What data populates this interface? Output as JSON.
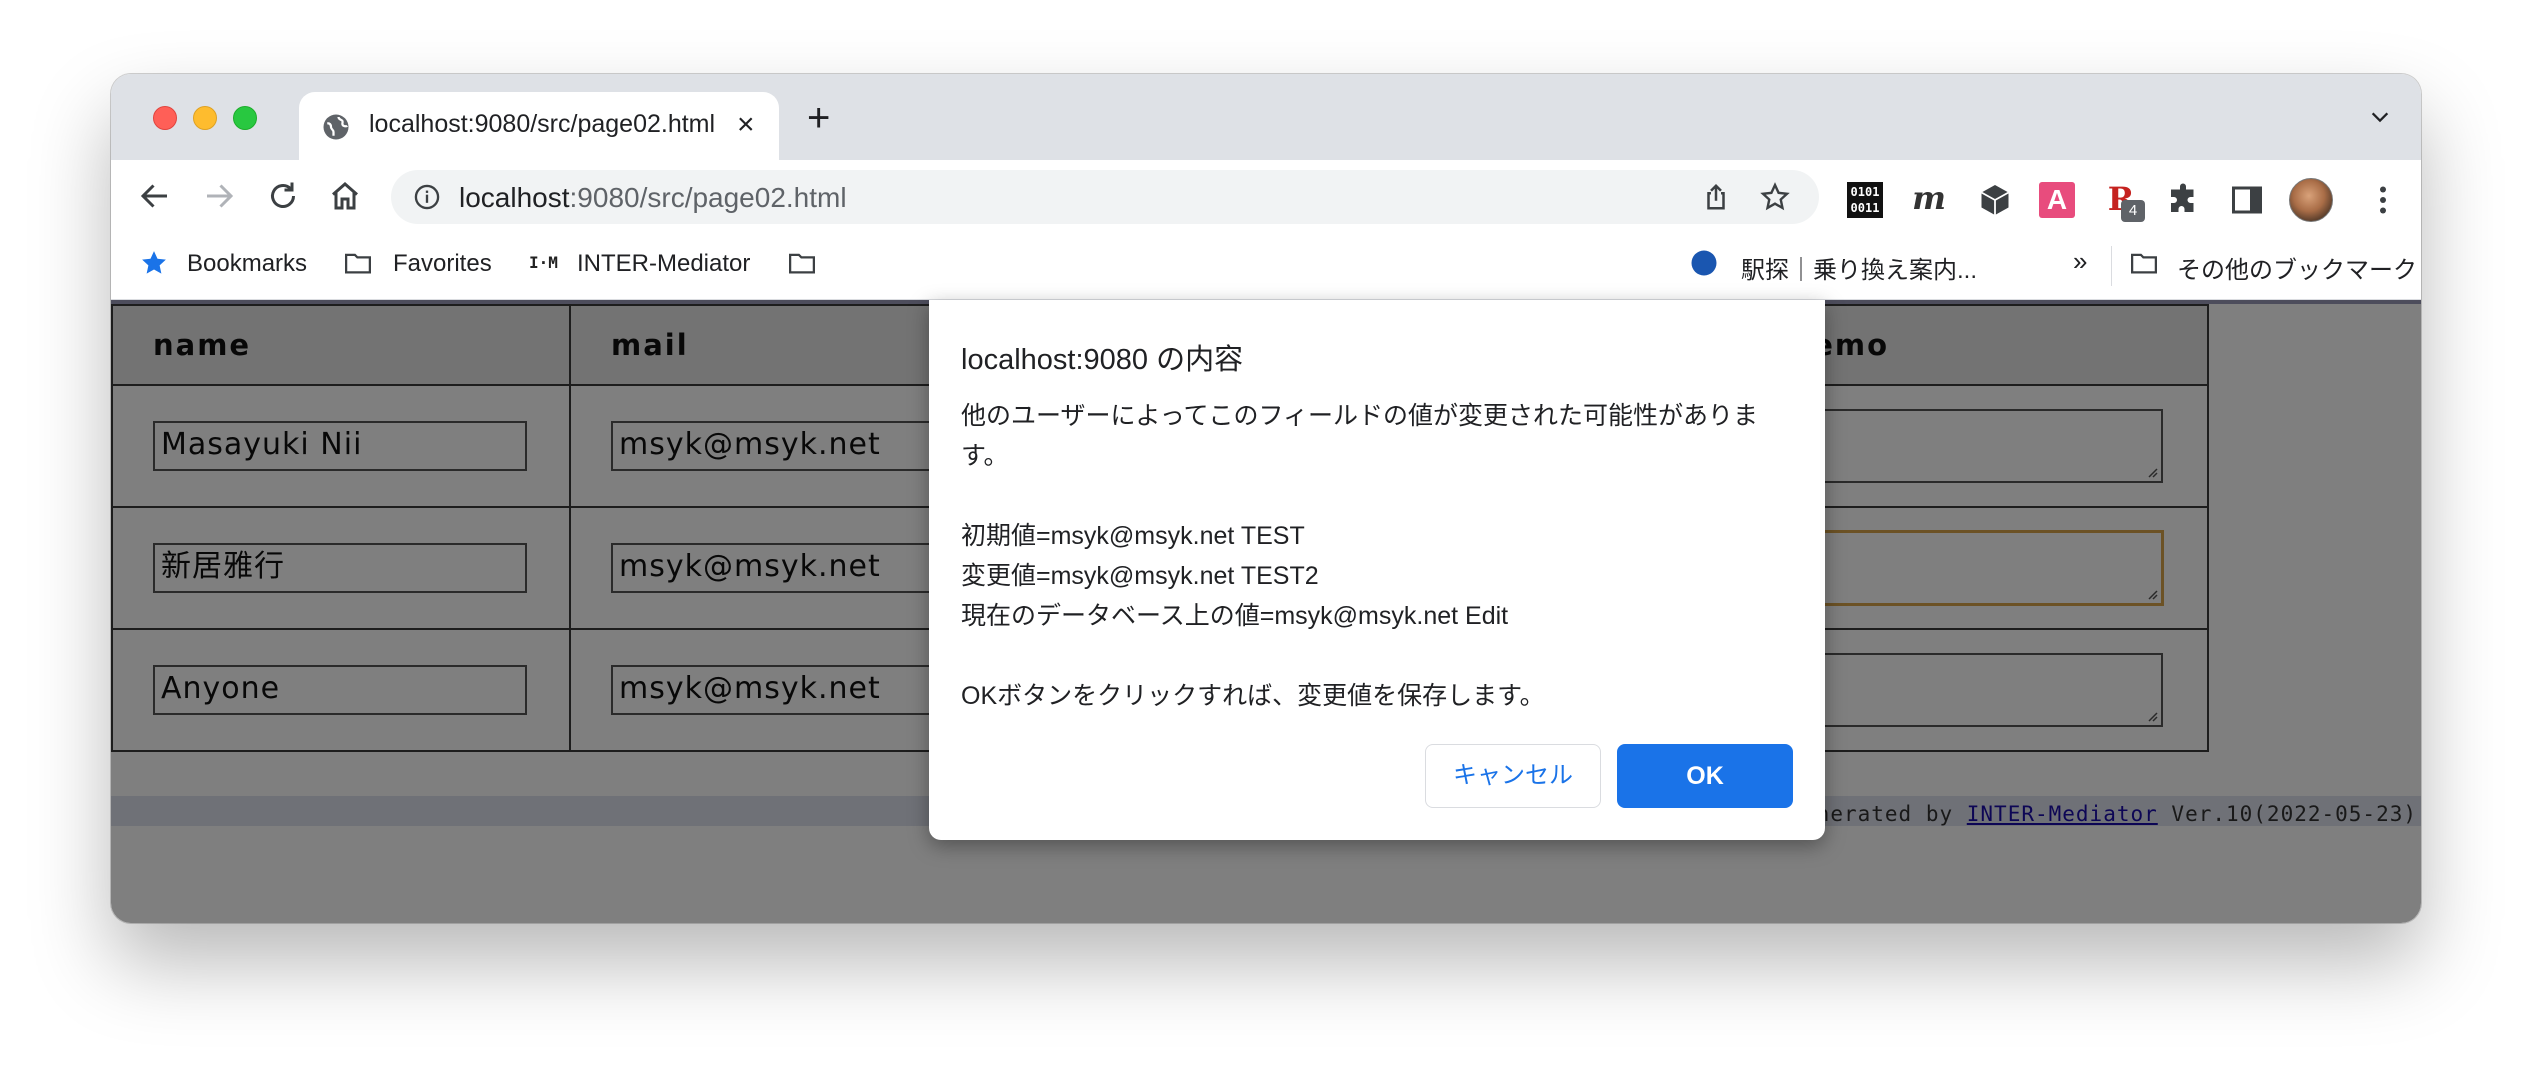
{
  "browser": {
    "tab_title": "localhost:9080/src/page02.html",
    "tab_close": "×",
    "new_tab": "+",
    "url_host": "localhost",
    "url_path": ":9080/src/page02.html",
    "profile_badge": "4",
    "extensions": {
      "binary_line1": "0101",
      "binary_line2": "0011",
      "m_label": "m",
      "a_label": "A",
      "r_label": "R"
    }
  },
  "bookmarks": {
    "items": [
      {
        "label": "Bookmarks"
      },
      {
        "label": "Favorites"
      },
      {
        "label": "INTER-Mediator"
      },
      {
        "label": "駅探｜乗り換え案内..."
      }
    ],
    "overflow": "»",
    "other": "その他のブックマーク",
    "im_logo": "I·M"
  },
  "table": {
    "headers": [
      "name",
      "mail",
      "memo"
    ],
    "rows": [
      {
        "name": "Masayuki Nii",
        "mail": "msyk@msyk.net"
      },
      {
        "name": "新居雅行",
        "mail": "msyk@msyk.net"
      },
      {
        "name": "Anyone",
        "mail": "msyk@msyk.net"
      }
    ]
  },
  "footer": {
    "prefix": "Generated by ",
    "link": "INTER-Mediator",
    "suffix": " Ver.10(2022-05-23)"
  },
  "dialog": {
    "title": "localhost:9080 の内容",
    "line1": "他のユーザーによってこのフィールドの値が変更された可能性があります。",
    "line2": "初期値=msyk@msyk.net TEST",
    "line3": "変更値=msyk@msyk.net TEST2",
    "line4": "現在のデータベース上の値=msyk@msyk.net Edit",
    "line5": "OKボタンをクリックすれば、変更値を保存します。",
    "cancel_label": "キャンセル",
    "ok_label": "OK"
  },
  "colors": {
    "accent": "#1a73e8",
    "focus_outline": "#d9a44a",
    "overlay": "rgba(0,0,0,0.5)"
  }
}
